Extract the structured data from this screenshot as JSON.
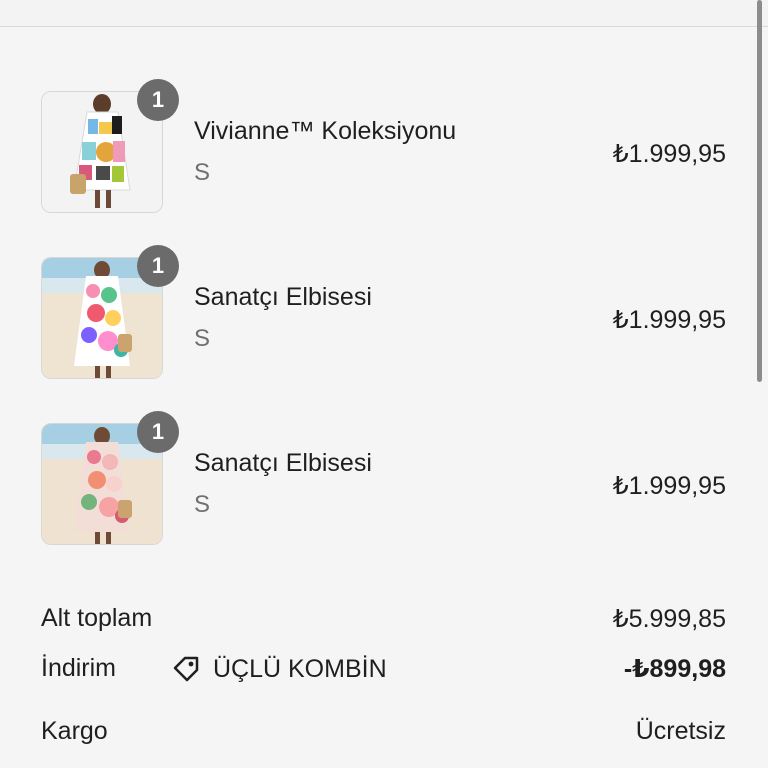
{
  "cart": {
    "items": [
      {
        "name": "Vivianne™ Koleksiyonu",
        "variant": "S",
        "price": "₺1.999,95",
        "quantity": "1"
      },
      {
        "name": "Sanatçı Elbisesi",
        "variant": "S",
        "price": "₺1.999,95",
        "quantity": "1"
      },
      {
        "name": "Sanatçı Elbisesi",
        "variant": "S",
        "price": "₺1.999,95",
        "quantity": "1"
      }
    ]
  },
  "summary": {
    "subtotal_label": "Alt toplam",
    "subtotal_value": "₺5.999,85",
    "discount_label": "İndirim",
    "discount_code": "ÜÇLÜ KOMBİN",
    "discount_value": "-₺899,98",
    "shipping_label": "Kargo",
    "shipping_value": "Ücretsiz"
  },
  "icons": {
    "discount": "tag-icon"
  },
  "colors": {
    "badge": "#6b6b6b",
    "text": "#1f1f1f",
    "muted": "#707070"
  }
}
